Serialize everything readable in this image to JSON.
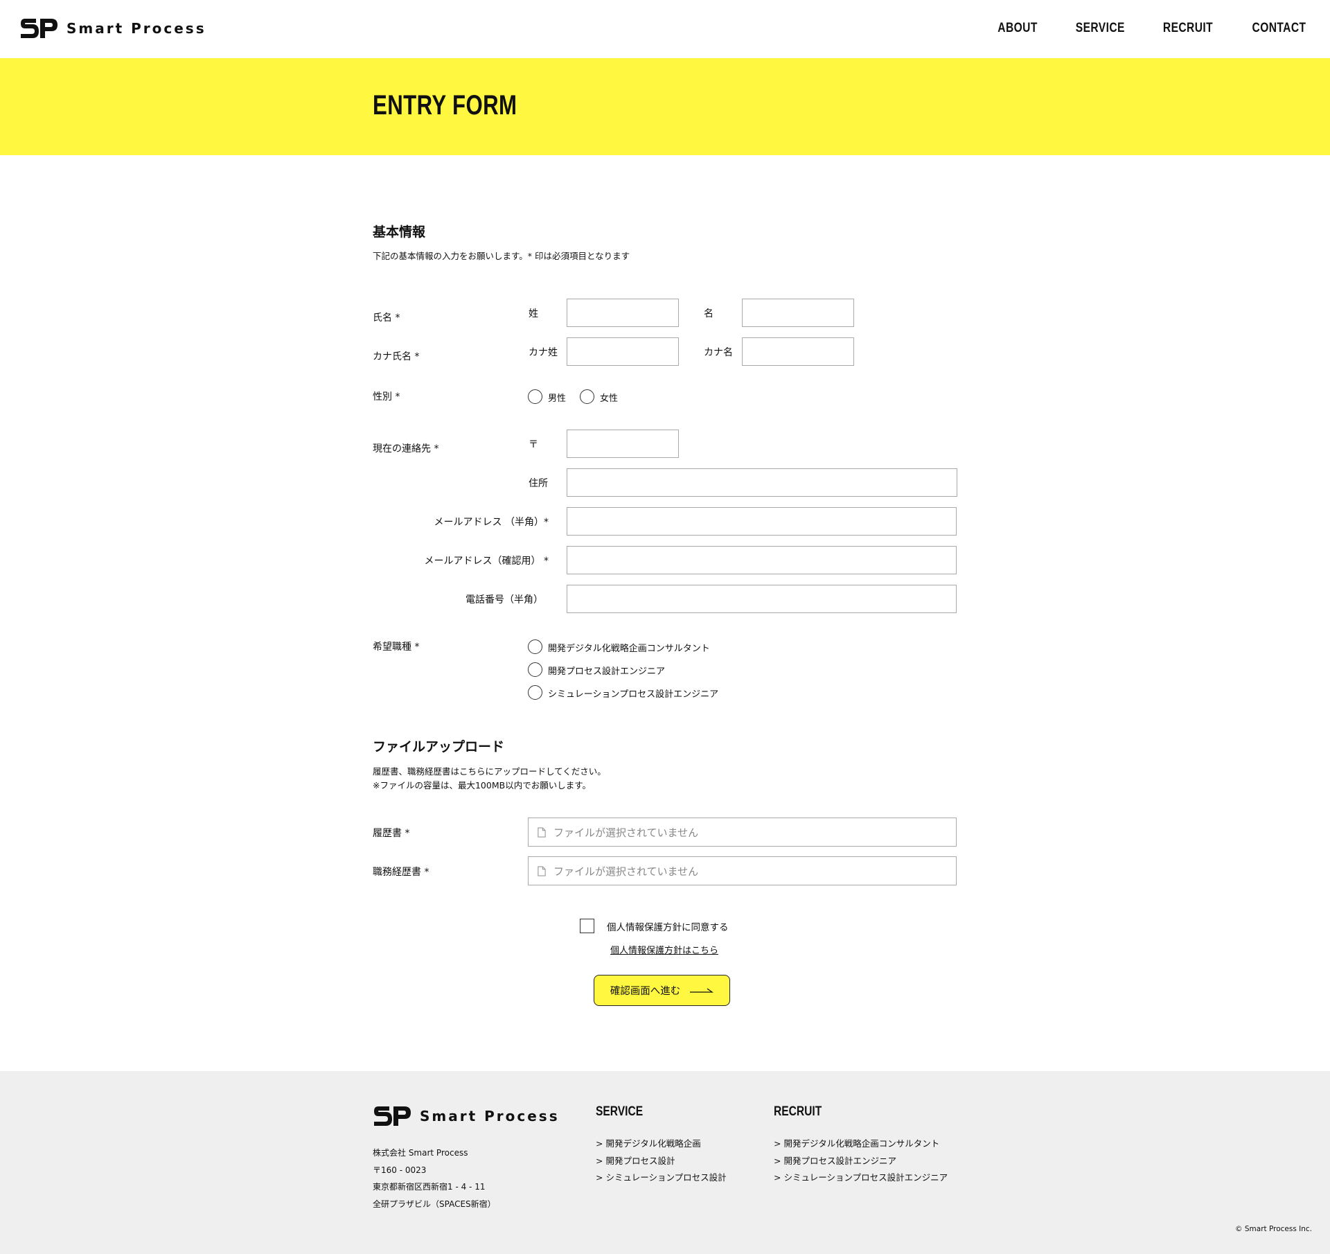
{
  "header": {
    "logo_text": "Smart Process",
    "nav": [
      "ABOUT",
      "SERVICE",
      "RECRUIT",
      "CONTACT"
    ]
  },
  "hero": {
    "title": "ENTRY FORM"
  },
  "basic": {
    "title": "基本情報",
    "desc": "下記の基本情報の入力をお願いします。* 印は必須項目となります",
    "name_label": "氏名 *",
    "sei": "姓",
    "mei": "名",
    "kana_label": "カナ氏名 *",
    "kana_sei": "カナ姓",
    "kana_mei": "カナ名",
    "gender_label": "性別 *",
    "male": "男性",
    "female": "女性",
    "contact_label": "現在の連絡先 *",
    "postal": "〒",
    "address": "住所",
    "email": "メールアドレス （半角）*",
    "email_confirm": "メールアドレス（確認用） *",
    "phone": "電話番号（半角）",
    "job_label": "希望職種 *",
    "jobs": [
      "開発デジタル化戦略企画コンサルタント",
      "開発プロセス設計エンジニア",
      "シミュレーションプロセス設計エンジニア"
    ]
  },
  "upload": {
    "title": "ファイルアップロード",
    "desc1": "履歴書、職務経歴書はこちらにアップロードしてください。",
    "desc2": "※ファイルの容量は、最大100MB以内でお願いします。",
    "resume_label": "履歴書 *",
    "cv_label": "職務経歴書 *",
    "no_file": "ファイルが選択されていません"
  },
  "agree": {
    "checkbox_label": "個人情報保護方針に同意する",
    "policy_link": "個人情報保護方針はこちら",
    "submit": "確認画面へ進む"
  },
  "footer": {
    "logo_text": "Smart Process",
    "address": [
      "株式会社 Smart Process",
      "〒160 - 0023",
      "東京都新宿区西新宿1 - 4 - 11",
      "全研プラザビル（SPACES新宿）"
    ],
    "service_title": "SERVICE",
    "service_items": [
      "> 開発デジタル化戦略企画",
      "> 開発プロセス設計",
      "> シミュレーションプロセス設計"
    ],
    "recruit_title": "RECRUIT",
    "recruit_items": [
      "> 開発デジタル化戦略企画コンサルタント",
      "> 開発プロセス設計エンジニア",
      "> シミュレーションプロセス設計エンジニア"
    ],
    "copyright": "© Smart Process Inc."
  },
  "colors": {
    "accent": "#fff740",
    "footer_bg": "#efefef"
  }
}
